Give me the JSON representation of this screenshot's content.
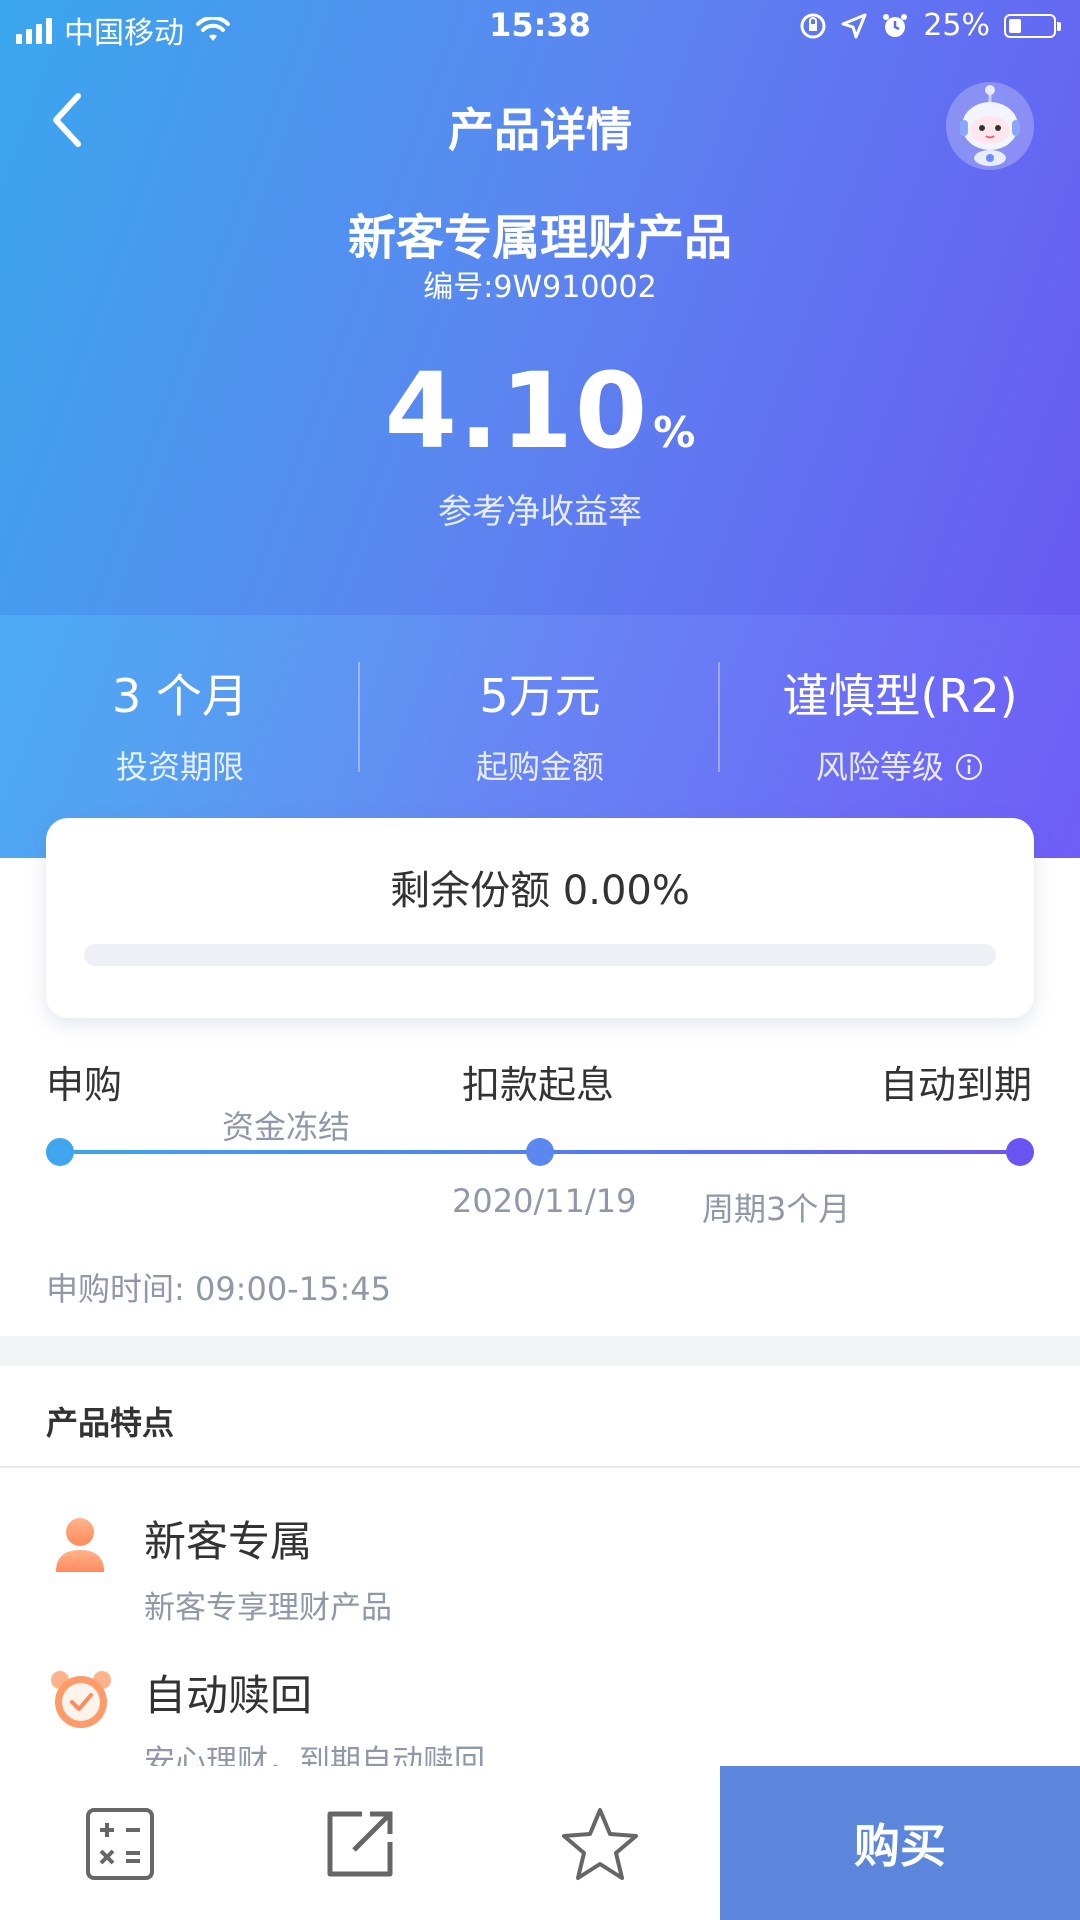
{
  "status_bar": {
    "carrier": "中国移动",
    "time": "15:38",
    "battery": "25%"
  },
  "nav": {
    "title": "产品详情"
  },
  "product": {
    "name": "新客专属理财产品",
    "code": "编号:9W910002",
    "rate_value": "4.10",
    "rate_unit": "%",
    "rate_label": "参考净收益率"
  },
  "stats": [
    {
      "value": "3 个月",
      "label": "投资期限"
    },
    {
      "value": "5万元",
      "label": "起购金额"
    },
    {
      "value": "谨慎型(R2)",
      "label": "风险等级"
    }
  ],
  "remaining": {
    "label": "剩余份额 0.00%",
    "progress_fraction": 0.0
  },
  "timeline": {
    "step1": "申购",
    "step2": "扣款起息",
    "step3": "自动到期",
    "between1": "资金冻结",
    "date": "2020/11/19",
    "period": "周期3个月",
    "subscribe_time": "申购时间: 09:00-15:45"
  },
  "features": {
    "title": "产品特点",
    "items": [
      {
        "title": "新客专属",
        "desc": "新客专享理财产品",
        "icon": "user-icon"
      },
      {
        "title": "自动赎回",
        "desc": "安心理财，到期自动赎回",
        "icon": "alarm-clock-icon"
      }
    ]
  },
  "bottom_bar": {
    "buy_label": "购买",
    "icons": [
      "calculator-icon",
      "share-icon",
      "star-icon"
    ]
  },
  "colors": {
    "gradient_start": "#3aa7ee",
    "gradient_end": "#6a54f3",
    "buy_button": "#5b86db"
  }
}
